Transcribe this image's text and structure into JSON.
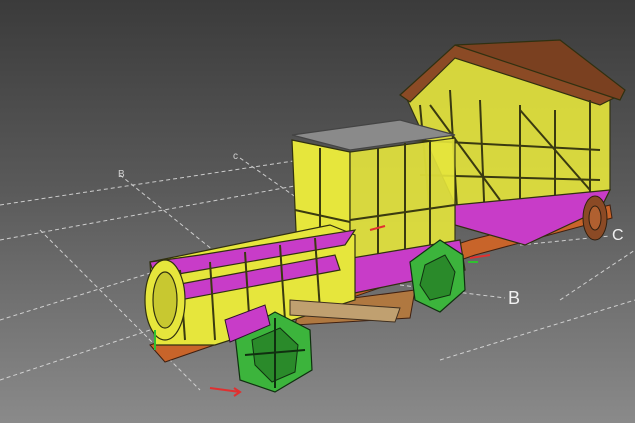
{
  "viewport": {
    "grid_labels": {
      "c_top": "c",
      "b_top": "B",
      "b_right": "B",
      "c_right": "C"
    },
    "colors": {
      "frame_yellow": "#e6e63c",
      "frame_magenta": "#c83cc8",
      "wheel_green": "#3cb43c",
      "roof_brown": "#8b4a25",
      "chassis_orange": "#c8642a",
      "grid_line": "#e0e0e0",
      "axis_red": "#e03030",
      "axis_green": "#30c030"
    }
  }
}
